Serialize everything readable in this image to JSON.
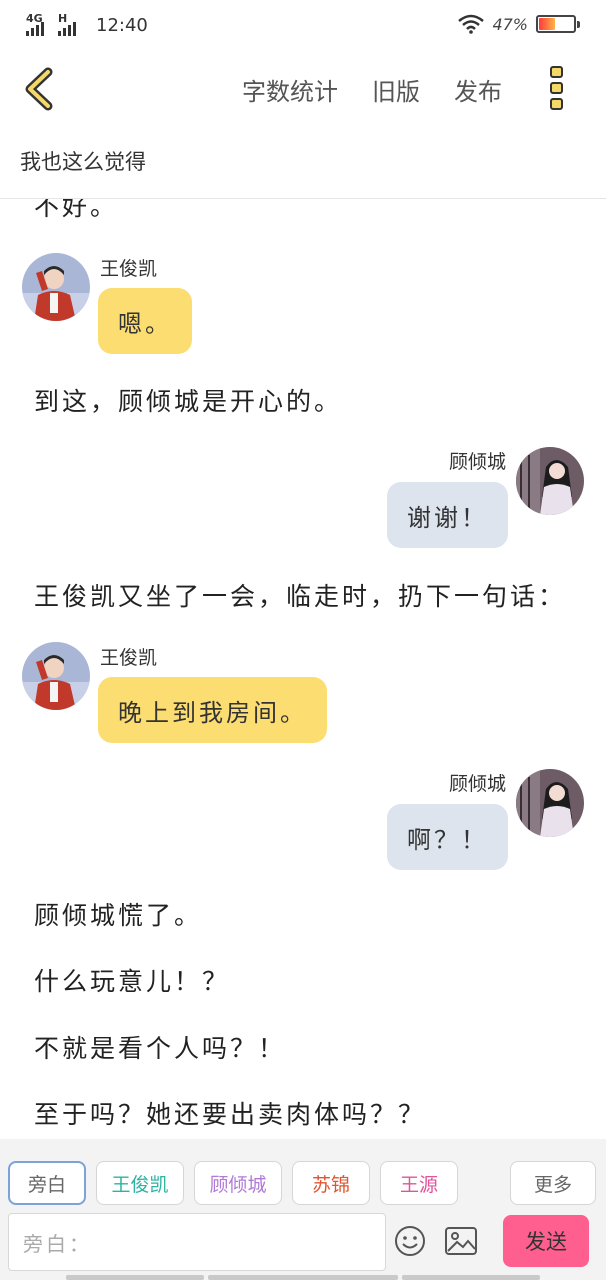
{
  "status": {
    "net1": "4G",
    "net2": "H",
    "time": "12:40",
    "battery": "47%",
    "battery_level": 0.47
  },
  "nav": {
    "word_count": "字数统计",
    "old_version": "旧版",
    "publish": "发布"
  },
  "chapter": {
    "title": "我也这么觉得"
  },
  "messages": [
    {
      "type": "narration",
      "text": "不好。"
    },
    {
      "type": "chat",
      "side": "left",
      "name": "王俊凯",
      "text": "嗯。"
    },
    {
      "type": "narration",
      "text": "到这，顾倾城是开心的。"
    },
    {
      "type": "chat",
      "side": "right",
      "name": "顾倾城",
      "text": "谢谢！"
    },
    {
      "type": "narration",
      "text": "王俊凯又坐了一会，临走时，扔下一句话："
    },
    {
      "type": "chat",
      "side": "left",
      "name": "王俊凯",
      "text": "晚上到我房间。"
    },
    {
      "type": "chat",
      "side": "right",
      "name": "顾倾城",
      "text": "啊？！"
    },
    {
      "type": "narration",
      "text": "顾倾城慌了。"
    },
    {
      "type": "narration",
      "text": "什么玩意儿！？"
    },
    {
      "type": "narration",
      "text": "不就是看个人吗？！"
    },
    {
      "type": "narration",
      "text": "至于吗？她还要出卖肉体吗？？"
    }
  ],
  "roles": [
    {
      "label": "旁白",
      "color": "#666666"
    },
    {
      "label": "王俊凯",
      "color": "#2bb3a3"
    },
    {
      "label": "顾倾城",
      "color": "#b07ad6"
    },
    {
      "label": "苏锦",
      "color": "#e0552f"
    },
    {
      "label": "王源",
      "color": "#e0559a"
    }
  ],
  "more_label": "更多",
  "input": {
    "placeholder": "旁白："
  },
  "send_label": "发送",
  "colors": {
    "left_bubble": "#fbdd72",
    "right_bubble": "#dde4ee",
    "send": "#ff5f8f",
    "active_tab_border": "#7aa3d8"
  }
}
